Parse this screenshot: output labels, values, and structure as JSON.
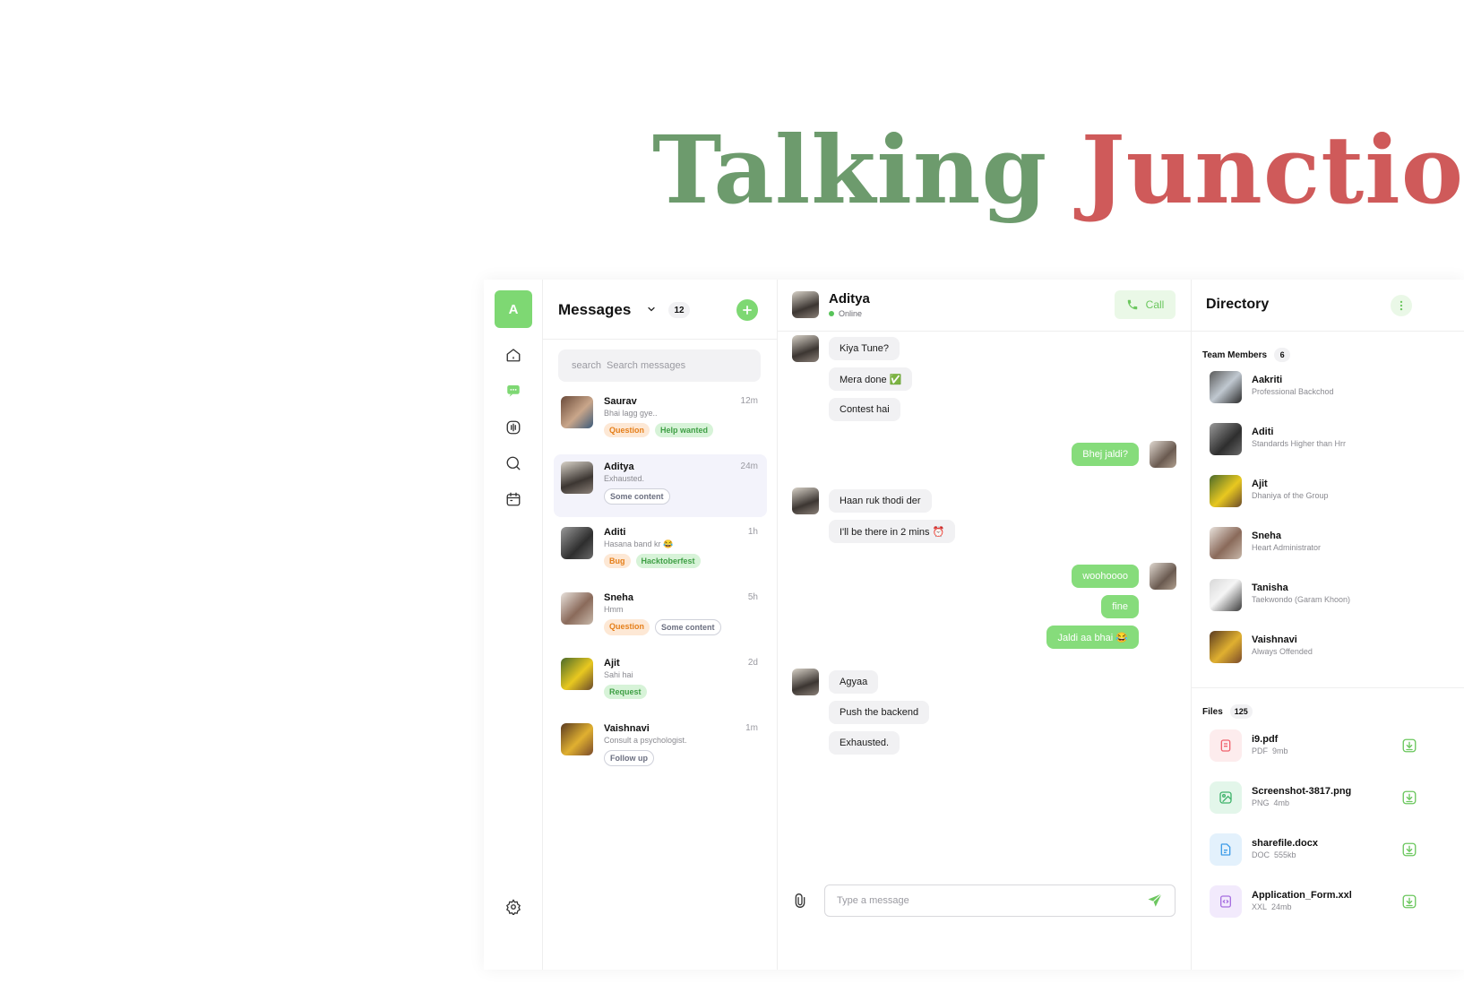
{
  "brand": {
    "word1": "Talking",
    "word2": "Junction"
  },
  "rail": {
    "avatar_letter": "A"
  },
  "messages": {
    "title": "Messages",
    "count": "12",
    "search": {
      "icon_label": "search",
      "placeholder": "Search messages"
    },
    "conversations": [
      {
        "name": "Saurav",
        "time": "12m",
        "preview": "Bhai lagg gye..",
        "tags": [
          "Question",
          "Help wanted"
        ]
      },
      {
        "name": "Aditya",
        "time": "24m",
        "preview": "Exhausted.",
        "tags": [
          "Some content"
        ]
      },
      {
        "name": "Aditi",
        "time": "1h",
        "preview": "Hasana band kr 😂",
        "tags": [
          "Bug",
          "Hacktoberfest"
        ]
      },
      {
        "name": "Sneha",
        "time": "5h",
        "preview": "Hmm",
        "tags": [
          "Question",
          "Some content"
        ]
      },
      {
        "name": "Ajit",
        "time": "2d",
        "preview": "Sahi hai",
        "tags": [
          "Request"
        ]
      },
      {
        "name": "Vaishnavi",
        "time": "1m",
        "preview": "Consult a psychologist.",
        "tags": [
          "Follow up"
        ]
      }
    ]
  },
  "chat": {
    "name": "Aditya",
    "status": "Online",
    "call_label": "Call",
    "messages": [
      {
        "dir": "in",
        "text": "Kiya Tune?"
      },
      {
        "dir": "in",
        "text": "Mera done ✅"
      },
      {
        "dir": "in",
        "text": "Contest hai"
      },
      {
        "dir": "out",
        "text": "Bhej jaldi?"
      },
      {
        "dir": "in",
        "text": "Haan ruk thodi der"
      },
      {
        "dir": "in",
        "text": "I'll be there in 2 mins ⏰"
      },
      {
        "dir": "out",
        "text": "woohoooo"
      },
      {
        "dir": "out",
        "text": "fine"
      },
      {
        "dir": "out",
        "text": "Jaldi aa bhai 😂"
      },
      {
        "dir": "in",
        "text": "Agyaa"
      },
      {
        "dir": "in",
        "text": "Push the backend"
      },
      {
        "dir": "in",
        "text": "Exhausted."
      }
    ],
    "composer_placeholder": "Type a message"
  },
  "directory": {
    "title": "Directory",
    "team_title": "Team Members",
    "team_count": "6",
    "members": [
      {
        "name": "Aakriti",
        "role": "Professional Backchod"
      },
      {
        "name": "Aditi",
        "role": "Standards Higher than Hrr"
      },
      {
        "name": "Ajit",
        "role": "Dhaniya of the Group"
      },
      {
        "name": "Sneha",
        "role": "Heart Administrator"
      },
      {
        "name": "Tanisha",
        "role": "Taekwondo (Garam Khoon)"
      },
      {
        "name": "Vaishnavi",
        "role": "Always Offended"
      }
    ],
    "files_title": "Files",
    "files_count": "125",
    "files": [
      {
        "name": "i9.pdf",
        "type": "PDF",
        "size": "9mb",
        "icon": "pdf-file-icon",
        "color": "#f0616d",
        "bg": "#fdeced"
      },
      {
        "name": "Screenshot-3817.png",
        "type": "PNG",
        "size": "4mb",
        "icon": "image-file-icon",
        "color": "#3fb36b",
        "bg": "#e3f6ea"
      },
      {
        "name": "sharefile.docx",
        "type": "DOC",
        "size": "555kb",
        "icon": "doc-file-icon",
        "color": "#3e9de8",
        "bg": "#e3f1fc"
      },
      {
        "name": "Application_Form.xxl",
        "type": "XXL",
        "size": "24mb",
        "icon": "code-file-icon",
        "color": "#a66ee0",
        "bg": "#f2eafc"
      }
    ]
  },
  "colors": {
    "accent": "#7ed873",
    "brand_green": "#6d9b6d",
    "brand_red": "#cf5a5a"
  }
}
